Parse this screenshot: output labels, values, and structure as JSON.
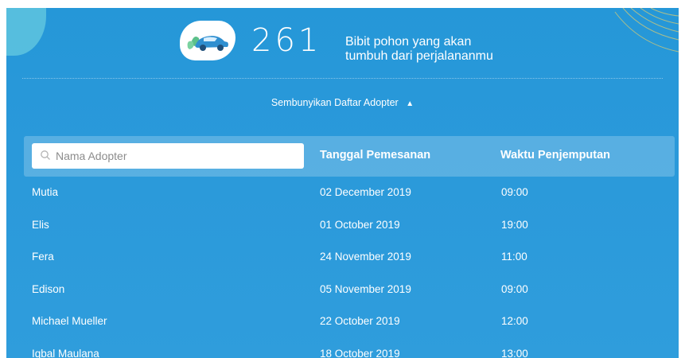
{
  "stats": {
    "count": "261",
    "caption_line1": "Bibit pohon yang akan",
    "caption_line2": "tumbuh dari perjalananmu"
  },
  "toggle": {
    "label": "Sembunyikan Daftar Adopter"
  },
  "table": {
    "search_placeholder": "Nama Adopter",
    "columns": [
      "Tanggal Pemesanan",
      "Waktu Penjemputan"
    ],
    "rows": [
      {
        "name": "Mutia",
        "date": "02 December 2019",
        "time": "09:00"
      },
      {
        "name": "Elis",
        "date": "01 October 2019",
        "time": "19:00"
      },
      {
        "name": "Fera",
        "date": "24 November 2019",
        "time": "11:00"
      },
      {
        "name": "Edison",
        "date": "05 November 2019",
        "time": "09:00"
      },
      {
        "name": "Michael Mueller",
        "date": "22 October 2019",
        "time": "12:00"
      },
      {
        "name": "Iqbal Maulana",
        "date": "18 October 2019",
        "time": "13:00"
      }
    ]
  },
  "colors": {
    "panel": "#2a99da",
    "blob": "#5fc4df",
    "deco": "#e6cf6a"
  }
}
